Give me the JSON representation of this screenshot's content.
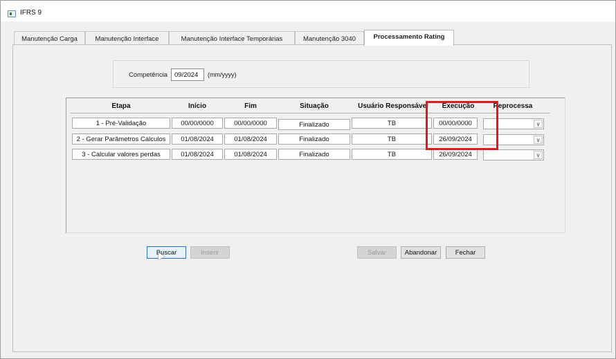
{
  "window": {
    "title": "IFRS 9"
  },
  "tabs": [
    {
      "label": "Manutenção Carga",
      "active": false
    },
    {
      "label": "Manutenção Interface",
      "active": false
    },
    {
      "label": "Manutenção Interface Temporárias",
      "active": false
    },
    {
      "label": "Manutenção 3040",
      "active": false
    },
    {
      "label": "Processamento Rating",
      "active": true
    }
  ],
  "competencia": {
    "label": "Competência",
    "value": "09/2024",
    "hint": "(mm/yyyy)"
  },
  "grid": {
    "columns": [
      "Etapa",
      "Início",
      "Fim",
      "Situação",
      "Usuário Responsável",
      "Execução",
      "Reprocessa"
    ],
    "rows": [
      {
        "etapa": "1 - Pré-Validação",
        "inicio": "00/00/0000",
        "fim": "00/00/0000",
        "situacao": "Finalizado",
        "usuario": "TB",
        "execucao": "00/00/0000",
        "reprocessa": ""
      },
      {
        "etapa": "2 - Gerar Parâmetros Cálculos",
        "inicio": "01/08/2024",
        "fim": "01/08/2024",
        "situacao": "Finalizado",
        "usuario": "TB",
        "execucao": "26/09/2024",
        "reprocessa": ""
      },
      {
        "etapa": "3 - Calcular valores perdas",
        "inicio": "01/08/2024",
        "fim": "01/08/2024",
        "situacao": "Finalizado",
        "usuario": "TB",
        "execucao": "26/09/2024",
        "reprocessa": ""
      }
    ]
  },
  "buttons": {
    "buscar": "Buscar",
    "inserir": "Inserir",
    "salvar": "Salvar",
    "abandonar": "Abandonar",
    "fechar": "Fechar"
  },
  "colors": {
    "highlight": "#e01820",
    "focus": "#2a6ec8"
  },
  "icons": {
    "app": "app-window-icon",
    "combo_arrow": "chevron-down-icon",
    "cursor": "mouse-pointer-icon"
  }
}
